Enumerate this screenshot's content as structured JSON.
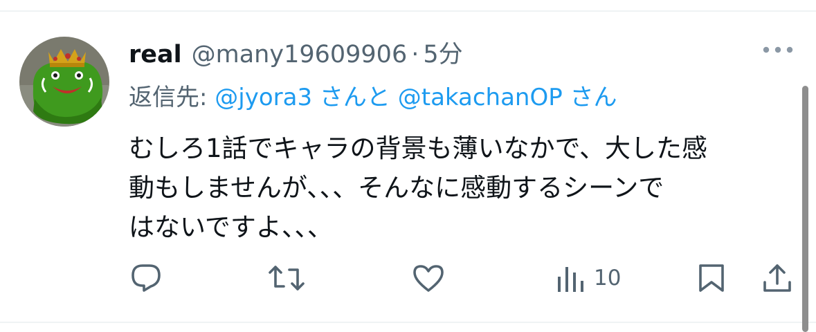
{
  "tweet": {
    "display_name": "real",
    "handle": "@many19609906",
    "separator": "·",
    "time": "5分",
    "reply_prefix": "返信先:",
    "reply_mention_1": "@jyora3",
    "reply_joiner_1": " さんと ",
    "reply_mention_2": "@takachanOP",
    "reply_suffix_2": " さん",
    "text_lines": [
      "むしろ1話でキャラの背景も薄いなかで、大した感",
      "動もしませんが、、、そんなに感動するシーンで",
      "はないですよ、、、"
    ]
  },
  "actions": {
    "views_count": "10"
  },
  "icons": {
    "avatar": "green-slime-king-avatar",
    "more": "more-dots-icon",
    "reply": "reply-icon",
    "retweet": "retweet-icon",
    "like": "like-icon",
    "views": "views-icon",
    "bookmark": "bookmark-icon",
    "share": "share-icon"
  },
  "colors": {
    "text": "#0f1419",
    "secondary": "#536471",
    "link": "#1d9bf0",
    "divider": "#eff3f4"
  }
}
